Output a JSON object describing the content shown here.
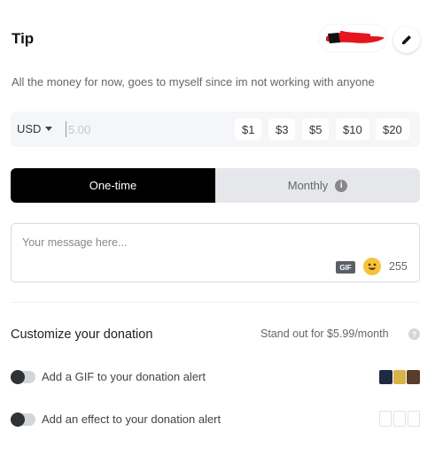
{
  "header": {
    "title": "Tip",
    "edit_icon": "pencil-icon",
    "description": "All the money for now, goes to myself since im not working with anyone"
  },
  "amount": {
    "currency": "USD",
    "placeholder": "5.00",
    "presets": [
      "$1",
      "$3",
      "$5",
      "$10",
      "$20"
    ]
  },
  "frequency": {
    "options": [
      "One-time",
      "Monthly"
    ],
    "selected": "One-time",
    "info_icon": "info-icon",
    "info_glyph": "i"
  },
  "message": {
    "placeholder": "Your message here...",
    "gif_label": "GIF",
    "emoji_icon": "smile-emoji-icon",
    "char_count": "255"
  },
  "customize": {
    "title": "Customize your donation",
    "standout": "Stand out for $5.99/month",
    "help_icon": "question-icon",
    "help_glyph": "?",
    "options": [
      {
        "label": "Add a GIF to your donation alert",
        "enabled": false
      },
      {
        "label": "Add an effect to your donation alert",
        "enabled": false
      }
    ]
  },
  "colors": {
    "accent": "#000000",
    "redaction": "#e5141e"
  }
}
